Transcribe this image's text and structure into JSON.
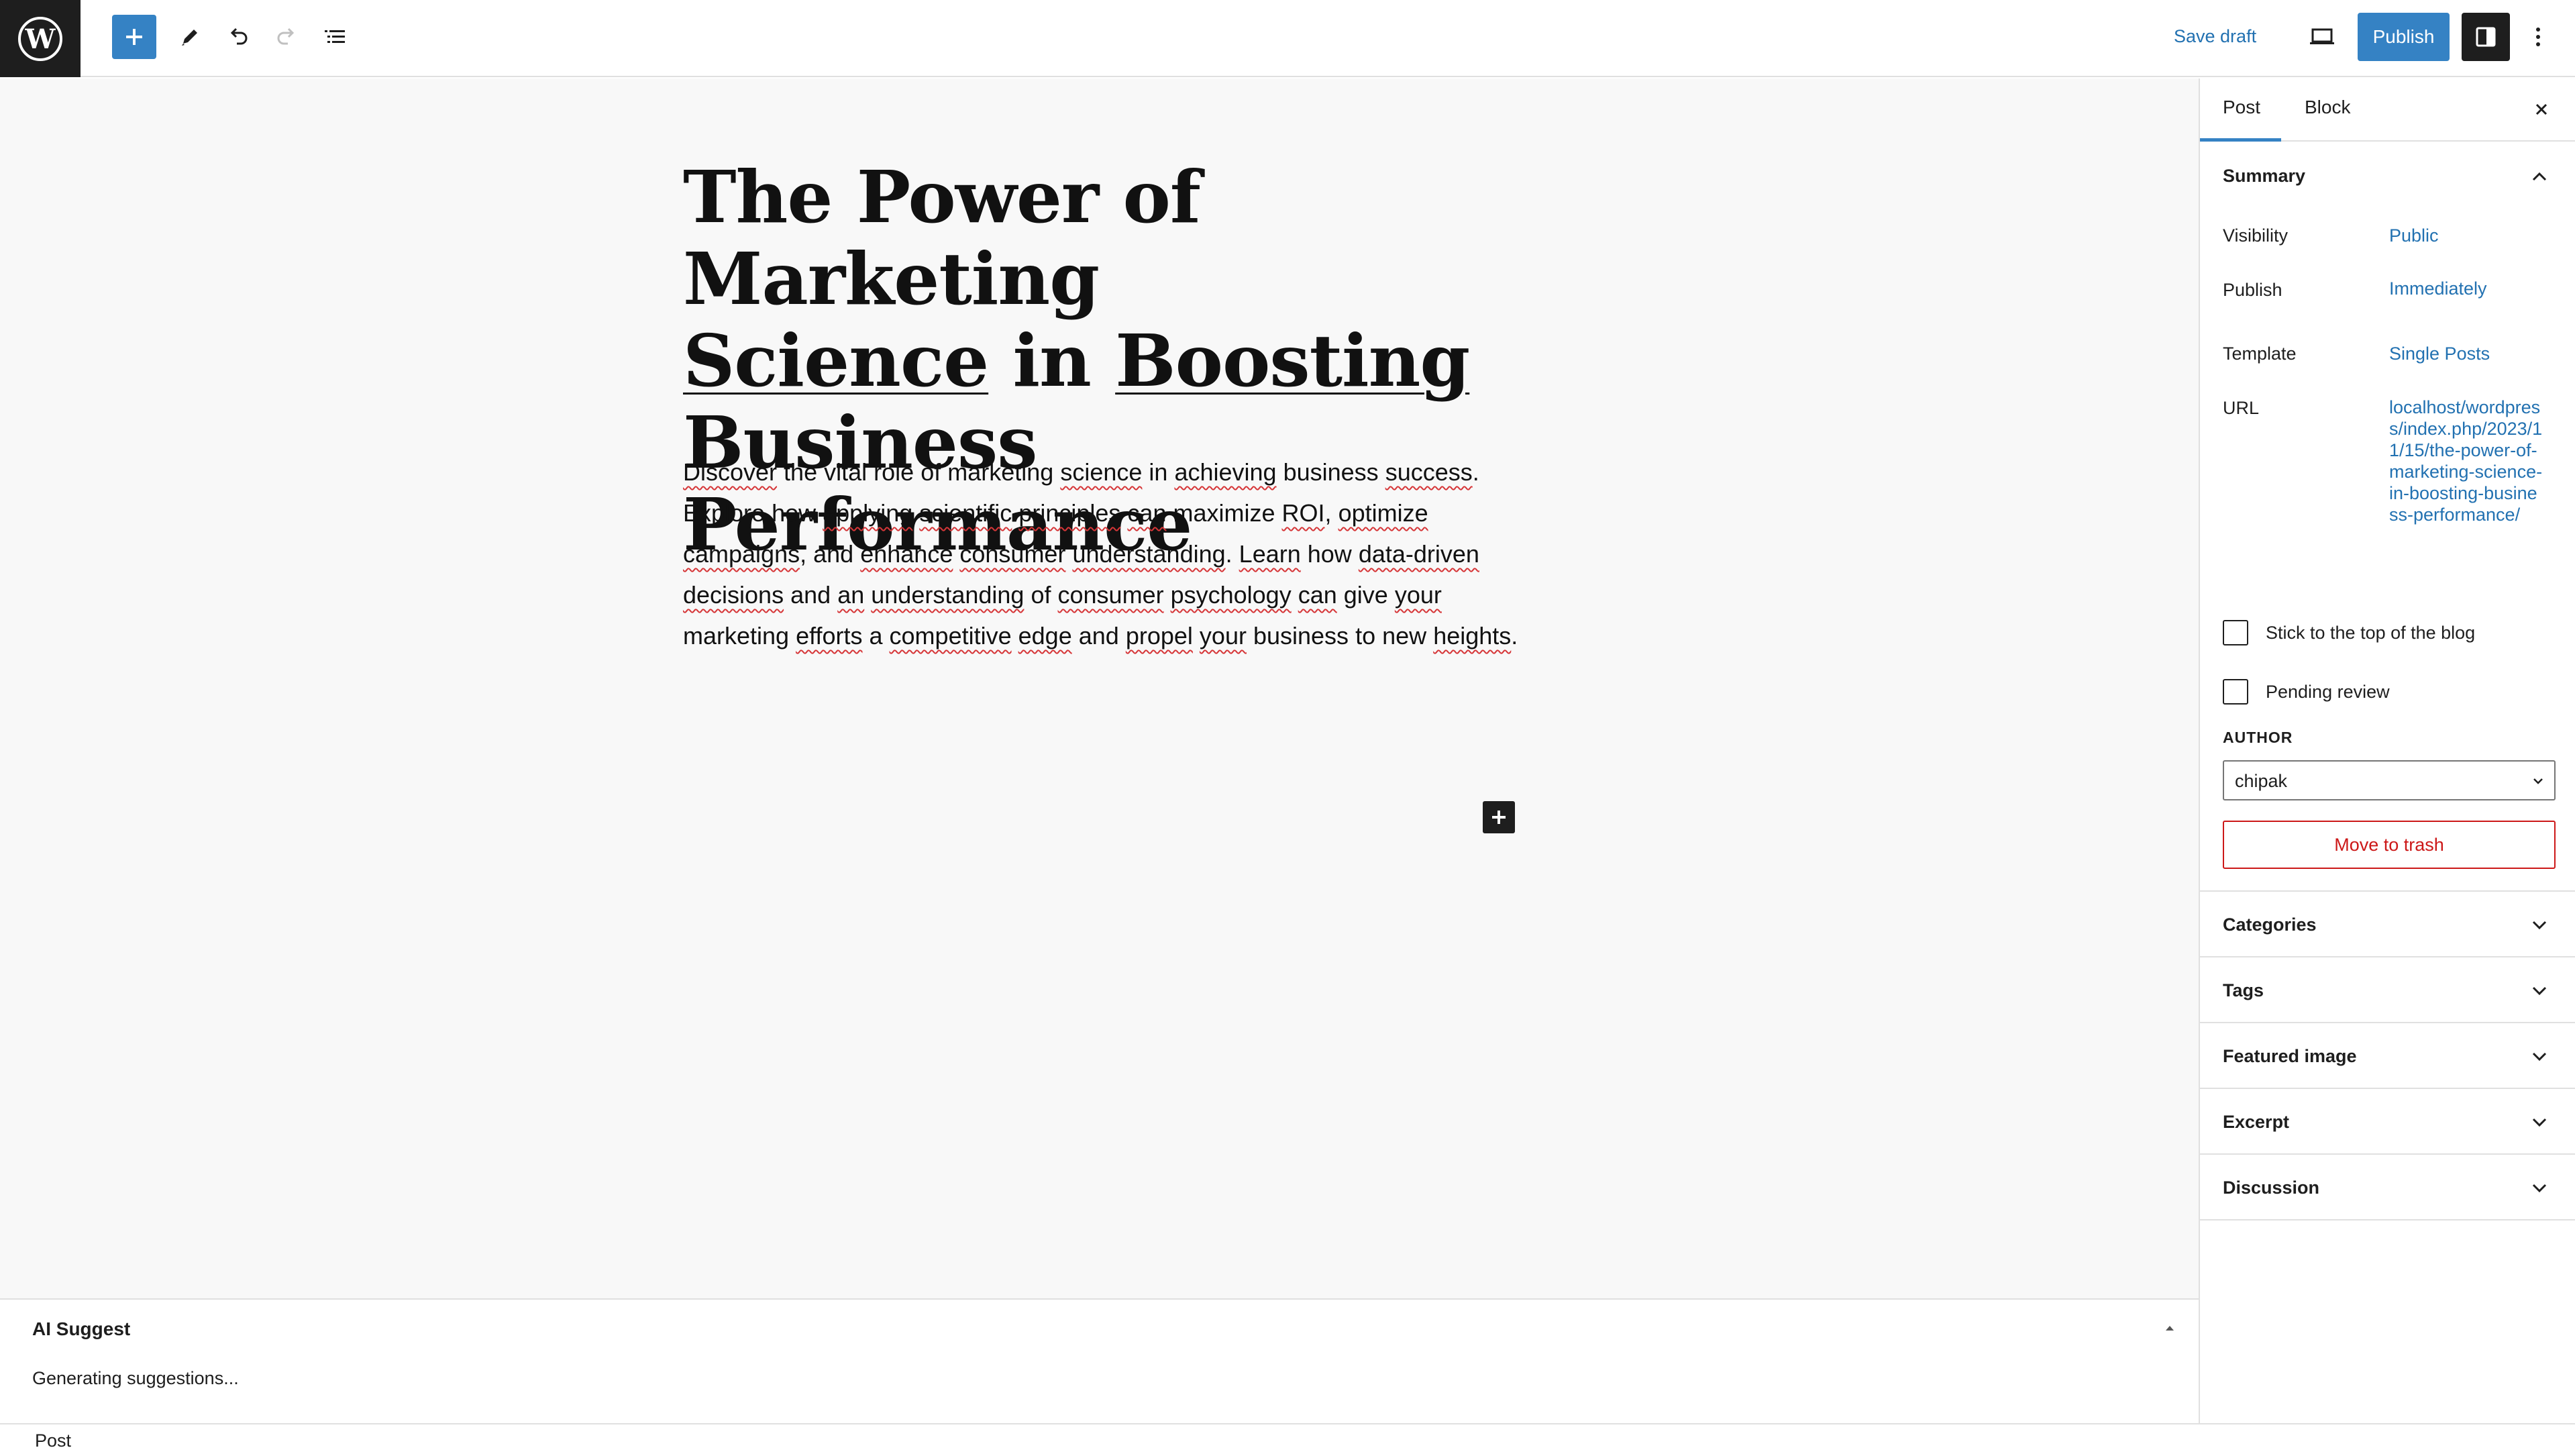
{
  "topbar": {
    "logo_icon": "wordpress-logo-icon",
    "add_block_icon": "plus-icon",
    "tools_icon": "pencil-icon",
    "undo_icon": "undo-icon",
    "redo_icon": "redo-icon",
    "document_overview_icon": "list-view-icon",
    "save_draft_label": "Save draft",
    "preview_icon": "desktop-icon",
    "publish_label": "Publish",
    "settings_icon": "sidebar-icon",
    "options_icon": "more-vertical-icon"
  },
  "editor": {
    "title_lines": [
      "The Power of Marketing",
      "Science in Boosting",
      "Business Performance"
    ],
    "title_underlined": [
      "Science",
      "Boosting"
    ],
    "paragraph": "Discover the vital role of marketing science in achieving business success. Explore how applying scientific principles can maximize ROI, optimize campaigns, and enhance consumer understanding. Learn how data-driven decisions and an understanding of consumer psychology can give your marketing efforts a competitive edge and propel your business to new heights.",
    "misspelled_words": [
      "Discover",
      "science",
      "achieving",
      "success",
      "applying",
      "scientific",
      "principles",
      "can",
      "ROI",
      "optimize",
      "campaigns",
      "enhance",
      "consumer",
      "understanding",
      "Learn",
      "data-driven",
      "decisions",
      "an",
      "psychology",
      "your",
      "efforts",
      "competitive",
      "edge",
      "propel",
      "heights"
    ],
    "inserter_icon": "plus-icon"
  },
  "ai_suggest": {
    "title": "AI Suggest",
    "status": "Generating suggestions...",
    "toggle_icon": "caret-up-icon"
  },
  "statusbar": {
    "label": "Post"
  },
  "sidebar": {
    "tabs": [
      {
        "label": "Post",
        "active": true
      },
      {
        "label": "Block",
        "active": false
      }
    ],
    "close_icon": "close-icon",
    "summary": {
      "title": "Summary",
      "rows": [
        {
          "label": "Visibility",
          "value": "Public"
        },
        {
          "label": "Publish",
          "value": "Immediately"
        },
        {
          "label": "Template",
          "value": "Single Posts"
        }
      ],
      "url_label": "URL",
      "url_value": "localhost/wordpress/index.php/2023/11/15/the-power-of-marketing-science-in-boosting-business-performance/",
      "checkboxes": [
        {
          "label": "Stick to the top of the blog",
          "checked": false
        },
        {
          "label": "Pending review",
          "checked": false
        }
      ],
      "author_label": "AUTHOR",
      "author_value": "chipak",
      "trash_label": "Move to trash"
    },
    "panels": [
      {
        "label": "Categories"
      },
      {
        "label": "Tags"
      },
      {
        "label": "Featured image"
      },
      {
        "label": "Excerpt"
      },
      {
        "label": "Discussion"
      }
    ]
  },
  "colors": {
    "accent": "#3582c4",
    "link": "#2271b1",
    "danger": "#cc1818",
    "dark": "#1e1e1e",
    "canvas_bg": "#f8f8f8"
  }
}
